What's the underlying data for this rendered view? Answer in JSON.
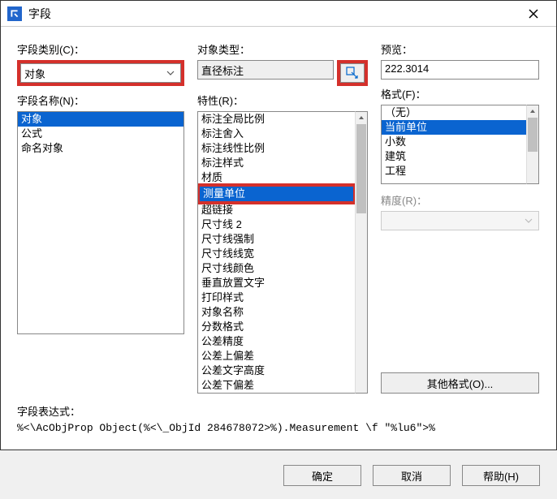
{
  "window": {
    "title": "字段"
  },
  "col1": {
    "category_label": "字段类别(C)：",
    "category_value": "对象",
    "names_label": "字段名称(N)：",
    "names_items": [
      "对象",
      "公式",
      "命名对象"
    ],
    "names_selected": 0
  },
  "col2": {
    "objtype_label": "对象类型：",
    "objtype_value": "直径标注",
    "props_label": "特性(R)：",
    "props_items": [
      "标注全局比例",
      "标注舍入",
      "标注线性比例",
      "标注样式",
      "材质",
      "测量单位",
      "超链接",
      "尺寸线 2",
      "尺寸线强制",
      "尺寸线线宽",
      "尺寸线颜色",
      "垂直放置文字",
      "打印样式",
      "对象名称",
      "分数格式",
      "公差精度",
      "公差上偏差",
      "公差文字高度",
      "公差下偏差"
    ],
    "props_selected": 5
  },
  "col3": {
    "preview_label": "预览：",
    "preview_value": "222.3014",
    "format_label": "格式(F)：",
    "format_items": [
      "（无）",
      "当前单位",
      "小数",
      "建筑",
      "工程"
    ],
    "format_selected": 1,
    "precision_label": "精度(R)：",
    "other_format_label": "其他格式(O)..."
  },
  "expression": {
    "label": "字段表达式：",
    "value": "%<\\AcObjProp Object(%<\\_ObjId 284678072>%).Measurement \\f \"%lu6\">%"
  },
  "buttons": {
    "ok": "确定",
    "cancel": "取消",
    "help": "帮助(H)"
  }
}
